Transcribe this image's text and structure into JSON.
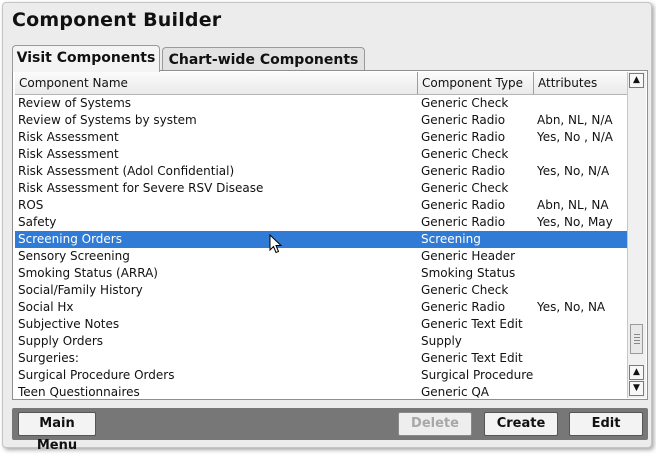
{
  "window": {
    "title": "Component Builder"
  },
  "tabs": [
    {
      "label": "Visit Components",
      "active": true
    },
    {
      "label": "Chart-wide Components",
      "active": false
    }
  ],
  "table": {
    "columns": [
      "Component Name",
      "Component Type",
      "Attributes"
    ],
    "rows": [
      [
        "Review of Systems",
        "Generic Check",
        ""
      ],
      [
        "Review of Systems by system",
        "Generic Radio",
        "Abn, NL, N/A"
      ],
      [
        "Risk Assessment",
        "Generic Radio",
        "Yes, No , N/A"
      ],
      [
        "Risk Assessment",
        "Generic Check",
        ""
      ],
      [
        "Risk Assessment (Adol Confidential)",
        "Generic Radio",
        "Yes, No, N/A"
      ],
      [
        "Risk Assessment for Severe RSV Disease",
        "Generic Check",
        ""
      ],
      [
        "ROS",
        "Generic Radio",
        "Abn, NL, NA"
      ],
      [
        "Safety",
        "Generic Radio",
        "Yes, No, May"
      ],
      [
        "Screening Orders",
        "Screening",
        ""
      ],
      [
        "Sensory Screening",
        "Generic Header",
        ""
      ],
      [
        "Smoking Status (ARRA)",
        "Smoking Status",
        ""
      ],
      [
        "Social/Family History",
        "Generic Check",
        ""
      ],
      [
        "Social Hx",
        "Generic Radio",
        "Yes, No, NA"
      ],
      [
        "Subjective Notes",
        "Generic Text Edit",
        ""
      ],
      [
        "Supply Orders",
        "Supply",
        ""
      ],
      [
        "Surgeries:",
        "Generic Text Edit",
        ""
      ],
      [
        "Surgical Procedure Orders",
        "Surgical Procedure",
        ""
      ],
      [
        "Teen Questionnaires",
        "Generic QA",
        ""
      ]
    ],
    "selected_index": 8
  },
  "buttons": {
    "main_menu": "Main Menu",
    "delete": "Delete",
    "create": "Create",
    "edit": "Edit"
  },
  "colors": {
    "selection": "#2f7bd6",
    "bottom_bar": "#777777"
  }
}
